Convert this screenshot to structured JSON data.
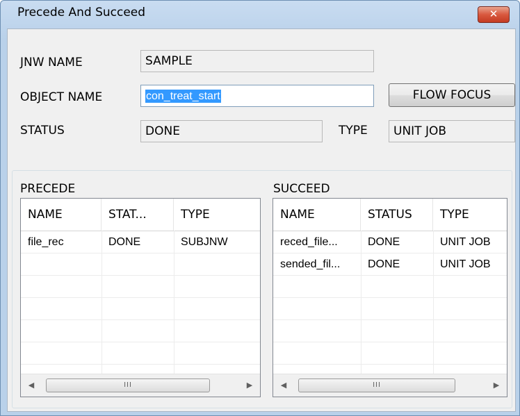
{
  "window": {
    "title": "Precede And Succeed",
    "close_glyph": "✕"
  },
  "form": {
    "jnw_name_label": "JNW NAME",
    "jnw_name_value": "SAMPLE",
    "object_name_label": "OBJECT NAME",
    "object_name_value": "con_treat_start",
    "flow_focus_label": "FLOW FOCUS",
    "status_label": "STATUS",
    "status_value": "DONE",
    "type_label": "TYPE",
    "type_value": "UNIT JOB"
  },
  "precede": {
    "label": "PRECEDE",
    "columns": [
      "NAME",
      "STAT...",
      "TYPE"
    ],
    "rows": [
      [
        "file_rec",
        "DONE",
        "SUBJNW"
      ]
    ]
  },
  "succeed": {
    "label": "SUCCEED",
    "columns": [
      "NAME",
      "STATUS",
      "TYPE"
    ],
    "rows": [
      [
        "reced_file...",
        "DONE",
        "UNIT JOB"
      ],
      [
        "sended_fil...",
        "DONE",
        "UNIT JOB"
      ]
    ]
  },
  "scrollbar": {
    "left_arrow": "◀",
    "right_arrow": "▶",
    "grip": "III"
  },
  "colors": {
    "selection": "#3399ff",
    "titlebar": "#c9dcf1",
    "close_button": "#d9583f"
  }
}
